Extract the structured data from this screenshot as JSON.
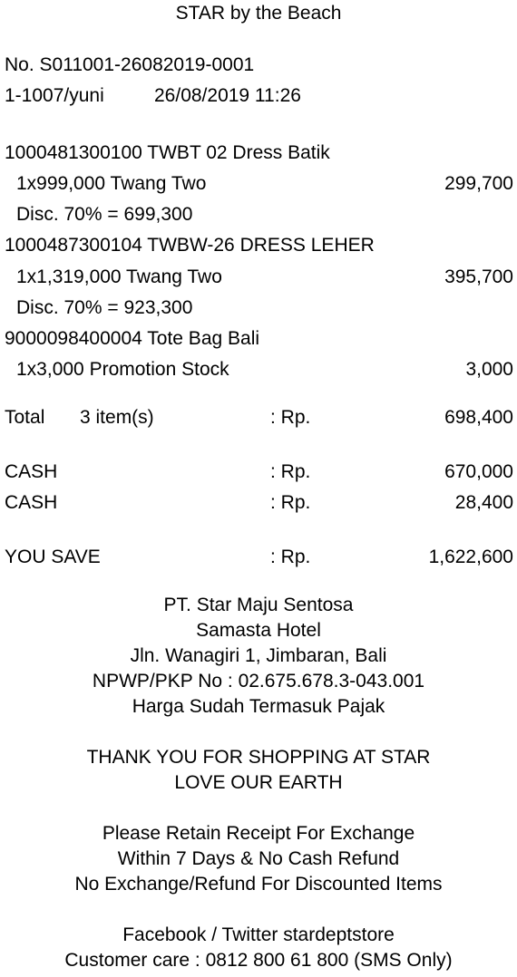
{
  "store_name": "STAR by the Beach",
  "receipt_no": "No. S011001-26082019-0001",
  "cashier": "1-1007/yuni",
  "datetime": "26/08/2019 11:26",
  "items": [
    {
      "code_desc": "1000481300100 TWBT 02 Dress Batik",
      "qty_line": "1x999,000 Twang Two",
      "amount": "299,700",
      "discount": "Disc. 70% = 699,300"
    },
    {
      "code_desc": "1000487300104 TWBW-26 DRESS LEHER",
      "qty_line": "1x1,319,000 Twang Two",
      "amount": "395,700",
      "discount": "Disc. 70% = 923,300"
    },
    {
      "code_desc": "9000098400004 Tote Bag Bali",
      "qty_line": "1x3,000 Promotion Stock",
      "amount": "3,000"
    }
  ],
  "total": {
    "label": "Total",
    "count": "3 item(s)",
    "currency": ": Rp.",
    "amount": "698,400"
  },
  "payments": [
    {
      "label": "CASH",
      "currency": ": Rp.",
      "amount": "670,000"
    },
    {
      "label": "CASH",
      "currency": ": Rp.",
      "amount": "28,400"
    }
  ],
  "savings": {
    "label": "YOU SAVE",
    "currency": ": Rp.",
    "amount": "1,622,600"
  },
  "footer": {
    "company": "PT. Star Maju Sentosa",
    "hotel": "Samasta Hotel",
    "address": "Jln. Wanagiri 1, Jimbaran, Bali",
    "npwp": "NPWP/PKP No : 02.675.678.3-043.001",
    "tax_note": "Harga Sudah Termasuk Pajak",
    "thanks": "THANK YOU FOR SHOPPING AT STAR",
    "slogan": "LOVE OUR EARTH",
    "policy1": "Please Retain Receipt For Exchange",
    "policy2": "Within 7 Days & No Cash Refund",
    "policy3": "No Exchange/Refund For Discounted Items",
    "social": "Facebook / Twitter stardeptstore",
    "care": "Customer care : 0812 800 61 800 (SMS Only)"
  }
}
